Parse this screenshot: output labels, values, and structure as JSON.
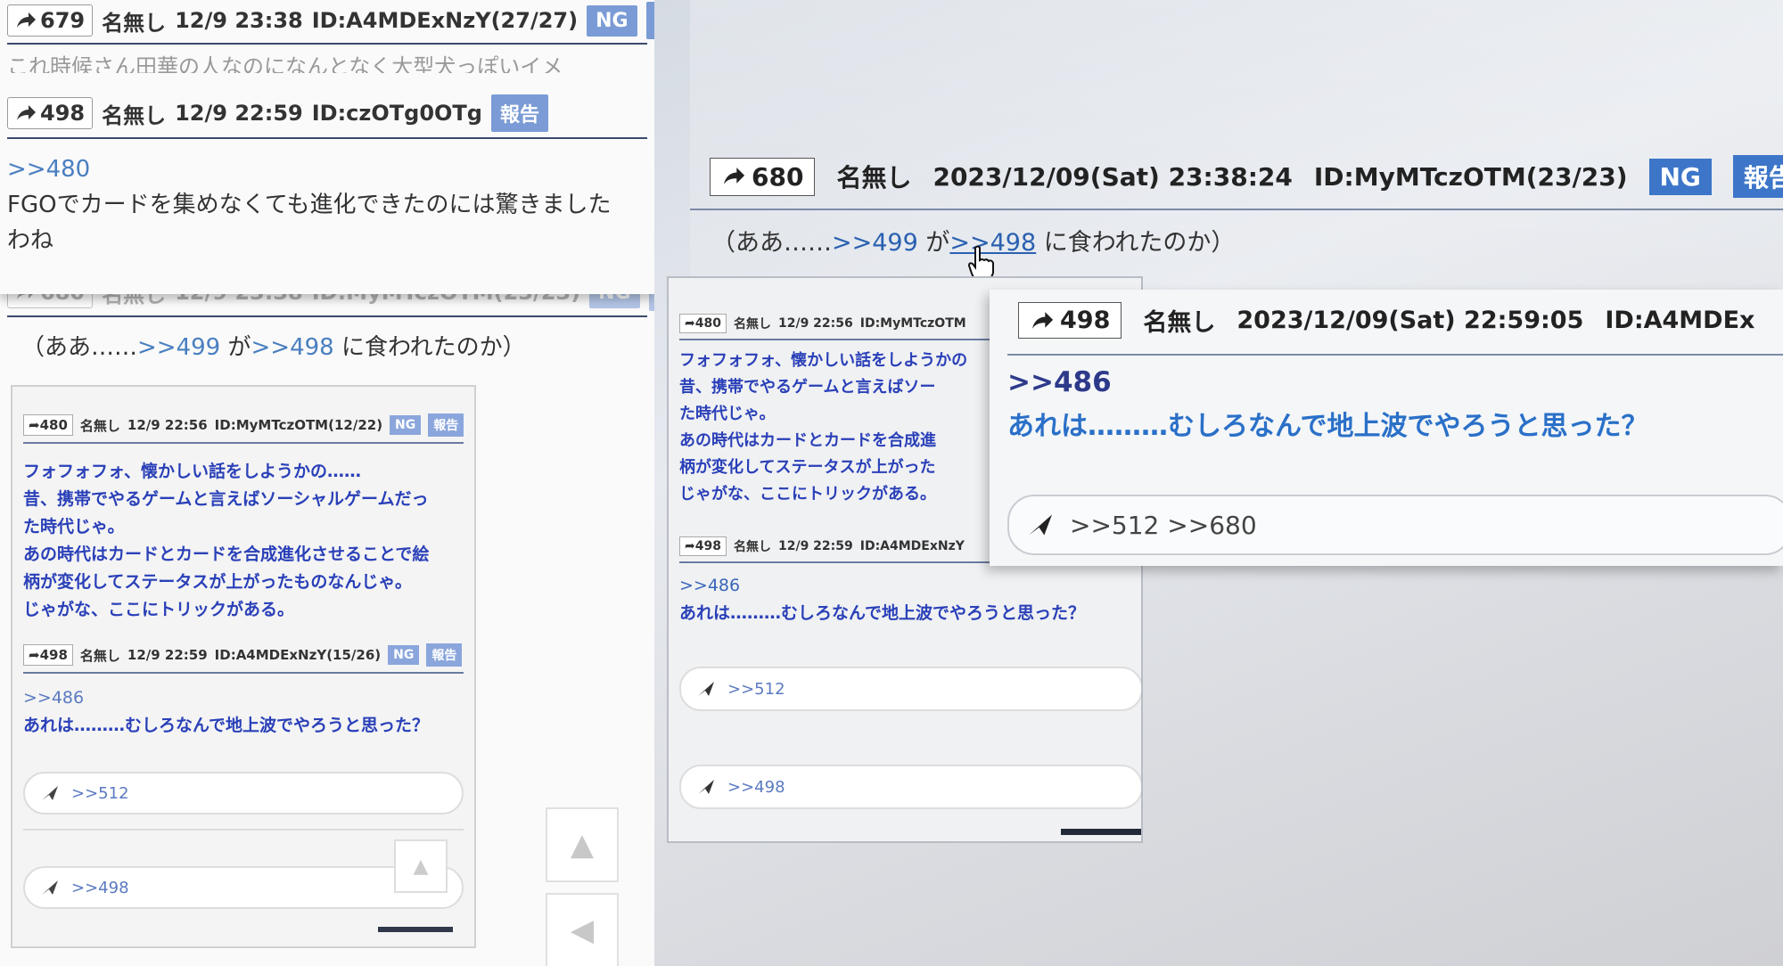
{
  "left": {
    "post679": {
      "no": "679",
      "name": "名無し",
      "datetime": "12/9 23:38",
      "id": "ID:A4MDExNzY(27/27)",
      "ng": "NG",
      "report": "報告",
      "cut_text": "これ時候さん田華の人なのになんとなく大型犬っぽいイメ"
    },
    "post498": {
      "no": "498",
      "name": "名無し",
      "datetime": "12/9 22:59",
      "id": "ID:czOTg0OTg",
      "report": "報告",
      "anchor": ">>480",
      "text1": "FGOでカードを集めなくても進化できたのには驚きました",
      "text2": "わね"
    },
    "post680": {
      "no": "680",
      "name": "名無し",
      "datetime": "12/9 23:38",
      "id": "ID:MyMTczOTM(23/23)",
      "ng": "NG",
      "report": "報告",
      "pre": "（ああ……",
      "a1": ">>499",
      "mid": "が",
      "a2": ">>498",
      "post": "に食われたのか）"
    },
    "embed": {
      "post480": {
        "no": "480",
        "name": "名無し",
        "datetime": "12/9 22:56",
        "id": "ID:MyMTczOTM(12/22)",
        "ng": "NG",
        "report": "報告",
        "lines": [
          "フォフォフォ、懐かしい話をしようかの……",
          "昔、携帯でやるゲームと言えばソーシャルゲームだっ",
          "た時代じゃ。",
          "あの時代はカードとカードを合成進化させることで絵",
          "柄が変化してステータスが上がったものなんじゃ。",
          "じゃがな、ここにトリックがある。"
        ]
      },
      "post498": {
        "no": "498",
        "name": "名無し",
        "datetime": "12/9 22:59",
        "id": "ID:A4MDExNzY(15/26)",
        "ng": "NG",
        "report": "報告",
        "anchor": ">>486",
        "text": "あれは………むしろなんで地上波でやろうと思った？"
      },
      "reply1": ">>512",
      "reply2": ">>498"
    }
  },
  "right": {
    "post680": {
      "no": "680",
      "name": "名無し",
      "datetime": "2023/12/09(Sat) 23:38:24",
      "id": "ID:MyMTczOTM(23/23)",
      "ng": "NG",
      "report": "報告",
      "pre": "（ああ……",
      "a1": ">>499",
      "mid": "が",
      "a2": ">>498",
      "post": "に食われたのか）"
    },
    "inner": {
      "post480": {
        "no": "480",
        "name": "名無し",
        "datetime": "12/9 22:56",
        "id": "ID:MyMTczOTM",
        "lines": [
          "フォフォフォ、懐かしい話をしようかの",
          "昔、携帯でやるゲームと言えばソー",
          "た時代じゃ。",
          "あの時代はカードとカードを合成進",
          "柄が変化してステータスが上がった",
          "じゃがな、ここにトリックがある。"
        ]
      },
      "post498": {
        "no": "498",
        "name": "名無し",
        "datetime": "12/9 22:59",
        "id": "ID:A4MDExNzY",
        "anchor": ">>486",
        "text": "あれは………むしろなんで地上波でやろうと思った？"
      },
      "reply1": ">>512",
      "reply2": ">>498"
    },
    "popup": {
      "no": "498",
      "name": "名無し",
      "datetime": "2023/12/09(Sat) 22:59:05",
      "id": "ID:A4MDEx",
      "anchor": ">>486",
      "text": "あれは………むしろなんで地上波でやろうと思った？",
      "replies": ">>512 >>680"
    }
  },
  "colors": {
    "badge_light": "#7a9bd6",
    "badge_dark": "#3d76c9",
    "anchor": "#4a7fc0",
    "quote_text": "#2a40b8",
    "popup_text": "#2a70c8"
  }
}
